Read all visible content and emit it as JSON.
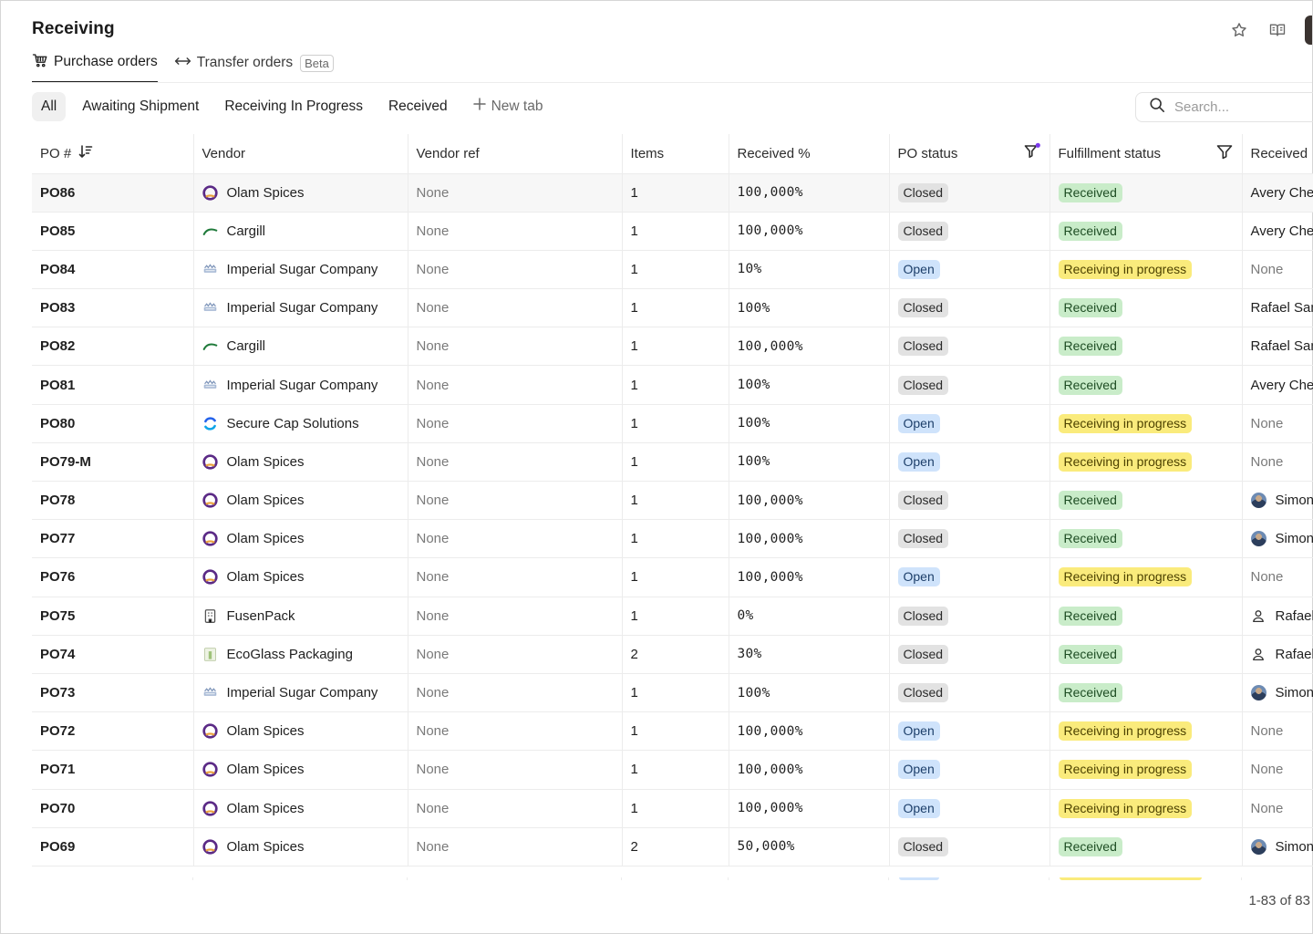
{
  "page": {
    "title": "Receiving"
  },
  "section_tabs": [
    {
      "label": "Purchase orders",
      "icon": "cart-icon",
      "active": true
    },
    {
      "label": "Transfer orders",
      "icon": "arrows-left-right-icon",
      "badge": "Beta",
      "active": false
    }
  ],
  "filter_tabs": [
    {
      "label": "All",
      "active": true
    },
    {
      "label": "Awaiting Shipment",
      "active": false
    },
    {
      "label": "Receiving In Progress",
      "active": false
    },
    {
      "label": "Received",
      "active": false
    }
  ],
  "new_tab_label": "New tab",
  "search": {
    "placeholder": "Search..."
  },
  "columns": {
    "po": "PO #",
    "vendor": "Vendor",
    "vendor_ref": "Vendor ref",
    "items": "Items",
    "received_pct": "Received %",
    "po_status": "PO status",
    "fulfillment_status": "Fulfillment status",
    "received_by": "Received"
  },
  "rows": [
    {
      "po": "PO86",
      "vendor": "Olam Spices",
      "vendor_logo": "olam-logo-icon",
      "vendor_ref": "None",
      "items": "1",
      "received_pct": "100,000%",
      "po_status": "Closed",
      "fulfillment": "Received",
      "received_by": "Avery Chen",
      "received_by_avatar": ""
    },
    {
      "po": "PO85",
      "vendor": "Cargill",
      "vendor_logo": "cargill-logo-icon",
      "vendor_ref": "None",
      "items": "1",
      "received_pct": "100,000%",
      "po_status": "Closed",
      "fulfillment": "Received",
      "received_by": "Avery Chen",
      "received_by_avatar": ""
    },
    {
      "po": "PO84",
      "vendor": "Imperial Sugar Company",
      "vendor_logo": "imperial-logo-icon",
      "vendor_ref": "None",
      "items": "1",
      "received_pct": "10%",
      "po_status": "Open",
      "fulfillment": "Receiving in progress",
      "received_by": "None",
      "received_by_avatar": ""
    },
    {
      "po": "PO83",
      "vendor": "Imperial Sugar Company",
      "vendor_logo": "imperial-logo-icon",
      "vendor_ref": "None",
      "items": "1",
      "received_pct": "100%",
      "po_status": "Closed",
      "fulfillment": "Received",
      "received_by": "Rafael Santos",
      "received_by_avatar": ""
    },
    {
      "po": "PO82",
      "vendor": "Cargill",
      "vendor_logo": "cargill-logo-icon",
      "vendor_ref": "None",
      "items": "1",
      "received_pct": "100,000%",
      "po_status": "Closed",
      "fulfillment": "Received",
      "received_by": "Rafael Santos",
      "received_by_avatar": ""
    },
    {
      "po": "PO81",
      "vendor": "Imperial Sugar Company",
      "vendor_logo": "imperial-logo-icon",
      "vendor_ref": "None",
      "items": "1",
      "received_pct": "100%",
      "po_status": "Closed",
      "fulfillment": "Received",
      "received_by": "Avery Chen",
      "received_by_avatar": ""
    },
    {
      "po": "PO80",
      "vendor": "Secure Cap Solutions",
      "vendor_logo": "securecap-logo-icon",
      "vendor_ref": "None",
      "items": "1",
      "received_pct": "100%",
      "po_status": "Open",
      "fulfillment": "Receiving in progress",
      "received_by": "None",
      "received_by_avatar": ""
    },
    {
      "po": "PO79-M",
      "vendor": "Olam Spices",
      "vendor_logo": "olam-logo-icon",
      "vendor_ref": "None",
      "items": "1",
      "received_pct": "100%",
      "po_status": "Open",
      "fulfillment": "Receiving in progress",
      "received_by": "None",
      "received_by_avatar": ""
    },
    {
      "po": "PO78",
      "vendor": "Olam Spices",
      "vendor_logo": "olam-logo-icon",
      "vendor_ref": "None",
      "items": "1",
      "received_pct": "100,000%",
      "po_status": "Closed",
      "fulfillment": "Received",
      "received_by": "Simon",
      "received_by_avatar": "photo"
    },
    {
      "po": "PO77",
      "vendor": "Olam Spices",
      "vendor_logo": "olam-logo-icon",
      "vendor_ref": "None",
      "items": "1",
      "received_pct": "100,000%",
      "po_status": "Closed",
      "fulfillment": "Received",
      "received_by": "Simon",
      "received_by_avatar": "photo"
    },
    {
      "po": "PO76",
      "vendor": "Olam Spices",
      "vendor_logo": "olam-logo-icon",
      "vendor_ref": "None",
      "items": "1",
      "received_pct": "100,000%",
      "po_status": "Open",
      "fulfillment": "Receiving in progress",
      "received_by": "None",
      "received_by_avatar": ""
    },
    {
      "po": "PO75",
      "vendor": "FusenPack",
      "vendor_logo": "fusenpack-logo-icon",
      "vendor_ref": "None",
      "items": "1",
      "received_pct": "0%",
      "po_status": "Closed",
      "fulfillment": "Received",
      "received_by": "Rafael",
      "received_by_avatar": "person"
    },
    {
      "po": "PO74",
      "vendor": "EcoGlass Packaging",
      "vendor_logo": "ecoglass-logo-icon",
      "vendor_ref": "None",
      "items": "2",
      "received_pct": "30%",
      "po_status": "Closed",
      "fulfillment": "Received",
      "received_by": "Rafael",
      "received_by_avatar": "person"
    },
    {
      "po": "PO73",
      "vendor": "Imperial Sugar Company",
      "vendor_logo": "imperial-logo-icon",
      "vendor_ref": "None",
      "items": "1",
      "received_pct": "100%",
      "po_status": "Closed",
      "fulfillment": "Received",
      "received_by": "Simon",
      "received_by_avatar": "photo"
    },
    {
      "po": "PO72",
      "vendor": "Olam Spices",
      "vendor_logo": "olam-logo-icon",
      "vendor_ref": "None",
      "items": "1",
      "received_pct": "100,000%",
      "po_status": "Open",
      "fulfillment": "Receiving in progress",
      "received_by": "None",
      "received_by_avatar": ""
    },
    {
      "po": "PO71",
      "vendor": "Olam Spices",
      "vendor_logo": "olam-logo-icon",
      "vendor_ref": "None",
      "items": "1",
      "received_pct": "100,000%",
      "po_status": "Open",
      "fulfillment": "Receiving in progress",
      "received_by": "None",
      "received_by_avatar": ""
    },
    {
      "po": "PO70",
      "vendor": "Olam Spices",
      "vendor_logo": "olam-logo-icon",
      "vendor_ref": "None",
      "items": "1",
      "received_pct": "100,000%",
      "po_status": "Open",
      "fulfillment": "Receiving in progress",
      "received_by": "None",
      "received_by_avatar": ""
    },
    {
      "po": "PO69",
      "vendor": "Olam Spices",
      "vendor_logo": "olam-logo-icon",
      "vendor_ref": "None",
      "items": "2",
      "received_pct": "50,000%",
      "po_status": "Closed",
      "fulfillment": "Received",
      "received_by": "Simon",
      "received_by_avatar": "photo"
    }
  ],
  "pagination": "1-83 of 83",
  "colors": {
    "closed_pill": "#e2e2e2",
    "open_pill": "#cfe3fb",
    "received_pill": "#c9ecc9",
    "progress_pill": "#faeb7c",
    "filter_active_dot": "#7c3aed",
    "row_highlight": "#f7f7f7"
  },
  "icons": [
    "star-icon",
    "book-icon",
    "cart-icon",
    "arrows-left-right-icon",
    "plus-icon",
    "search-icon",
    "sort-desc-icon",
    "filter-icon"
  ]
}
